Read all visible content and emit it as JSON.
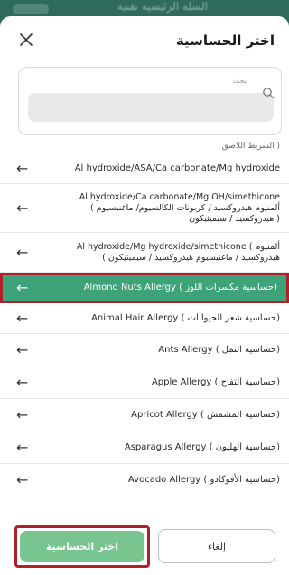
{
  "backdrop": {
    "title_fragment": "السلة الرئيسية تقنية"
  },
  "sheet": {
    "title": "اختر الحساسية",
    "close_symbol": "×"
  },
  "search": {
    "label": "بحث",
    "placeholder": "",
    "value": ""
  },
  "list": {
    "items": [
      {
        "id": "partial",
        "text_en": "",
        "text_ar": "( الشريط اللاصق",
        "arrow": "←",
        "selected": false
      },
      {
        "id": "al-asa",
        "text_en": "Al hydroxide/ASA/Ca carbonate/Mg hydroxide",
        "text_ar": "",
        "arrow": "←",
        "selected": false
      },
      {
        "id": "al-ca-mg-sim",
        "text_en": "Al hydroxide/Ca carbonate/Mg OH/simethicone",
        "text_ar": "ألمنيوم هيدروكسيد / كربونات الكالسيوم/ ماغنيسيوم )",
        "text_ar2": "( هيدروكسيد / سيميثيكون",
        "arrow": "←",
        "selected": false
      },
      {
        "id": "al-mg-sim",
        "text_en": "Al hydroxide/Mg hydroxide/simethicone ( ألمنيوم",
        "text_ar": "هيدروكسيد / ماغنيسيوم هيدروكسيد / سيميثيكون )",
        "arrow": "←",
        "selected": false
      },
      {
        "id": "almond",
        "text_en": "Almond Nuts Allergy ( حساسية مكسرات اللوز)",
        "text_ar": "",
        "arrow": "←",
        "selected": true
      },
      {
        "id": "animal-hair",
        "text_en": "Animal Hair Allergy ( حساسية شعر الحيوانات)",
        "text_ar": "",
        "arrow": "←",
        "selected": false
      },
      {
        "id": "ants",
        "text_en": "Ants Allergy ( حساسية النمل)",
        "text_ar": "",
        "arrow": "←",
        "selected": false
      },
      {
        "id": "apple",
        "text_en": "Apple Allergy ( حساسية التفاح)",
        "text_ar": "",
        "arrow": "←",
        "selected": false
      },
      {
        "id": "apricot",
        "text_en": "Apricot Allergy ( حساسية المشمش)",
        "text_ar": "",
        "arrow": "←",
        "selected": false
      },
      {
        "id": "asparagus",
        "text_en": "Asparagus Allergy ( حساسية الهليون)",
        "text_ar": "",
        "arrow": "←",
        "selected": false
      },
      {
        "id": "avocado",
        "text_en": "Avocado Allergy ( حساسية الأفوكادو)",
        "text_ar": "",
        "arrow": "←",
        "selected": false
      }
    ]
  },
  "footer": {
    "select_label": "اختر الحساسية",
    "cancel_label": "إلغاء"
  },
  "colors": {
    "accent": "#3fa37a",
    "select_button": "#79c58f",
    "highlight_outline": "#b0202a",
    "backdrop": "#2f6b5c"
  },
  "icons": {
    "close": "close-icon",
    "search": "search-icon",
    "row_arrow": "arrow-left-icon"
  }
}
